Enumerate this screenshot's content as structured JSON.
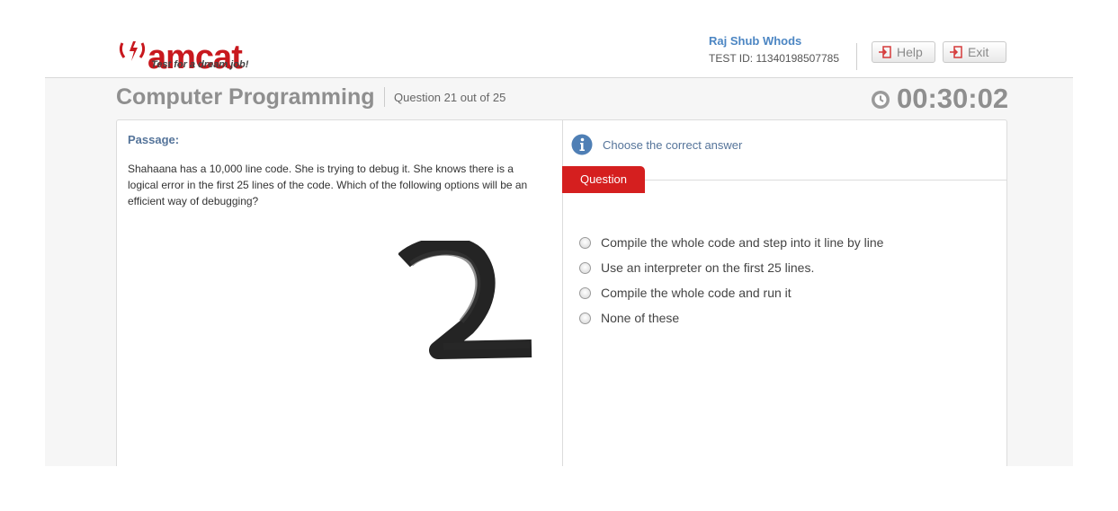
{
  "header": {
    "logo_text": "amcat",
    "logo_tagline": "Test for a dream job!",
    "user_name": "Raj Shub Whods",
    "test_id": "TEST ID: 11340198507785",
    "help_label": "Help",
    "exit_label": "Exit"
  },
  "section": {
    "title": "Computer Programming",
    "question_count": "Question 21 out of 25",
    "timer": "00:30:02"
  },
  "passage": {
    "label": "Passage:",
    "text": "Shahaana has a 10,000 line code. She is trying to debug it. She knows there is a logical error in the first 25 lines of the code. Which of the following options will be an efficient way of debugging?"
  },
  "question": {
    "instruction": "Choose the correct answer",
    "tab_label": "Question",
    "options": [
      {
        "label": "Compile the whole code and step into it line by line"
      },
      {
        "label": "Use an interpreter on the first 25 lines."
      },
      {
        "label": "Compile the whole code and run it"
      },
      {
        "label": "None of these"
      }
    ]
  },
  "annotation": {
    "scribble_glyph": "2"
  },
  "colors": {
    "brand_red": "#c8181e",
    "tab_red": "#d51f1f",
    "link_blue": "#55749a",
    "title_gray": "#8f8f8f"
  }
}
